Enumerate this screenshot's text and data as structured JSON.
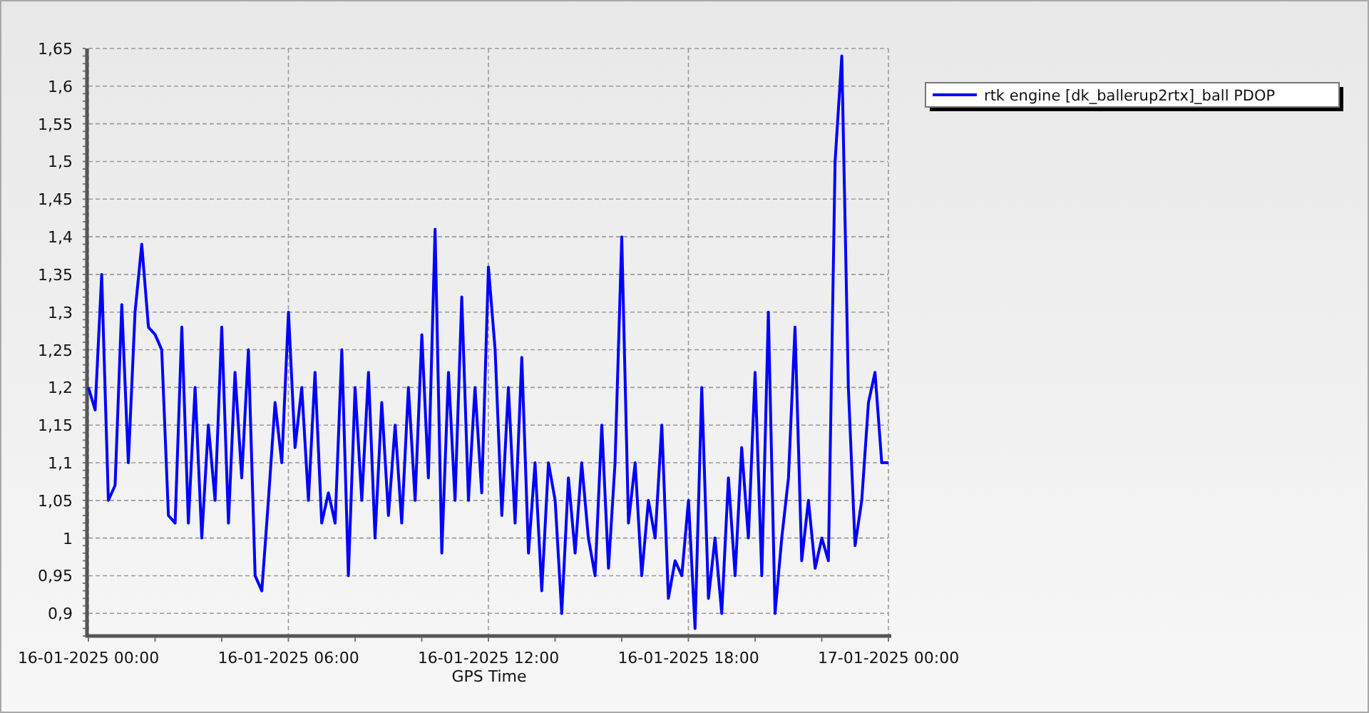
{
  "chart": {
    "chart_data": {
      "type": "line",
      "xlabel": "GPS Time",
      "categories": [
        "16-01-2025 00:00",
        null,
        null,
        null,
        null,
        null,
        null,
        null,
        null,
        null,
        null,
        null,
        null,
        null,
        null,
        null,
        null,
        null,
        null,
        null,
        null,
        null,
        null,
        null,
        null,
        null,
        null,
        null,
        null,
        null,
        "16-01-2025 06:00",
        null,
        null,
        null,
        null,
        null,
        null,
        null,
        null,
        null,
        null,
        null,
        null,
        null,
        null,
        null,
        null,
        null,
        null,
        null,
        null,
        null,
        null,
        null,
        null,
        null,
        null,
        null,
        null,
        null,
        "16-01-2025 12:00",
        null,
        null,
        null,
        null,
        null,
        null,
        null,
        null,
        null,
        null,
        null,
        null,
        null,
        null,
        null,
        null,
        null,
        null,
        null,
        null,
        null,
        null,
        null,
        null,
        null,
        null,
        null,
        null,
        null,
        "16-01-2025 18:00",
        null,
        null,
        null,
        null,
        null,
        null,
        null,
        null,
        null,
        null,
        null,
        null,
        null,
        null,
        null,
        null,
        null,
        null,
        null,
        null,
        null,
        null,
        null,
        null,
        null,
        null,
        null,
        null,
        null,
        "17-01-2025 00:00"
      ],
      "series": [
        {
          "name": "rtk engine [dk_ballerup2rtx]_ball PDOP",
          "color": "#0000ff",
          "values": [
            1.2,
            1.17,
            1.35,
            1.05,
            1.07,
            1.31,
            1.1,
            1.3,
            1.39,
            1.28,
            1.27,
            1.25,
            1.03,
            1.02,
            1.28,
            1.02,
            1.2,
            1.0,
            1.15,
            1.05,
            1.28,
            1.02,
            1.22,
            1.08,
            1.25,
            0.95,
            0.93,
            1.05,
            1.18,
            1.1,
            1.3,
            1.12,
            1.2,
            1.05,
            1.22,
            1.02,
            1.06,
            1.02,
            1.25,
            0.95,
            1.2,
            1.05,
            1.22,
            1.0,
            1.18,
            1.03,
            1.15,
            1.02,
            1.2,
            1.05,
            1.27,
            1.08,
            1.41,
            0.98,
            1.22,
            1.05,
            1.32,
            1.05,
            1.2,
            1.06,
            1.36,
            1.25,
            1.03,
            1.2,
            1.02,
            1.24,
            0.98,
            1.1,
            0.93,
            1.1,
            1.05,
            0.9,
            1.08,
            0.98,
            1.1,
            1.0,
            0.95,
            1.15,
            0.96,
            1.1,
            1.4,
            1.02,
            1.1,
            0.95,
            1.05,
            1.0,
            1.15,
            0.92,
            0.97,
            0.95,
            1.05,
            0.88,
            1.2,
            0.92,
            1.0,
            0.9,
            1.08,
            0.95,
            1.12,
            1.0,
            1.22,
            0.95,
            1.3,
            0.9,
            1.0,
            1.08,
            1.28,
            0.97,
            1.05,
            0.96,
            1.0,
            0.97,
            1.5,
            1.64,
            1.2,
            0.99,
            1.05,
            1.18,
            1.22,
            1.1,
            1.1
          ]
        }
      ],
      "ylim": [
        0.87,
        1.65
      ],
      "grid": true,
      "yticks": [
        {
          "value": 0.9,
          "label": "0,9"
        },
        {
          "value": 0.95,
          "label": "0,95"
        },
        {
          "value": 1,
          "label": "1"
        },
        {
          "value": 1.05,
          "label": "1,05"
        },
        {
          "value": 1.1,
          "label": "1,1"
        },
        {
          "value": 1.15,
          "label": "1,15"
        },
        {
          "value": 1.2,
          "label": "1,2"
        },
        {
          "value": 1.25,
          "label": "1,25"
        },
        {
          "value": 1.3,
          "label": "1,3"
        },
        {
          "value": 1.35,
          "label": "1,35"
        },
        {
          "value": 1.4,
          "label": "1,4"
        },
        {
          "value": 1.45,
          "label": "1,45"
        },
        {
          "value": 1.5,
          "label": "1,5"
        },
        {
          "value": 1.55,
          "label": "1,55"
        },
        {
          "value": 1.6,
          "label": "1,6"
        },
        {
          "value": 1.65,
          "label": "1,65"
        }
      ]
    }
  }
}
